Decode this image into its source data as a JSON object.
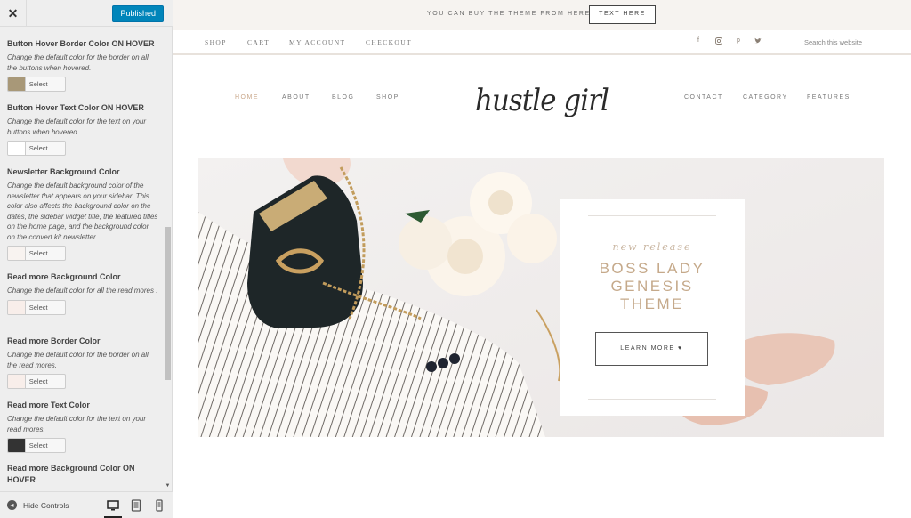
{
  "sidebar": {
    "close_icon": "close-icon",
    "published_label": "Published",
    "settings": [
      {
        "title": "Button Hover Border Color ON HOVER",
        "desc": "Change the default color for the border on all the buttons when hovered.",
        "color": "#a89878",
        "picker_label": "Select Color"
      },
      {
        "title": "Button Hover Text Color ON HOVER",
        "desc": "Change the default color for the text on your buttons when hovered.",
        "color": "#ffffff",
        "picker_label": "Select Color"
      },
      {
        "title": "Newsletter Background Color",
        "desc": "Change the default background color of the newsletter that appears on your sidebar. This color also affects the background color on the dates, the sidebar widget title, the featured titles on the home page, and the background color on the convert kit newsletter.",
        "color": "#f8f3f0",
        "picker_label": "Select Color"
      },
      {
        "title": "Read more Background Color",
        "desc": "Change the default color for all the read mores .",
        "color": "#f8eeea",
        "picker_label": "Select Color"
      },
      {
        "title": "Read more Border Color",
        "desc": "Change the default color for the border on all the read mores.",
        "color": "#f8eeea",
        "picker_label": "Select Color"
      },
      {
        "title": "Read more Text Color",
        "desc": "Change the default color for the text on your read mores.",
        "color": "#333333",
        "picker_label": "Select Color"
      },
      {
        "title": "Read more Background Color ON HOVER",
        "desc": "",
        "color": "",
        "picker_label": ""
      }
    ],
    "hide_controls_label": "Hide Controls",
    "devices": [
      "desktop-icon",
      "tablet-icon",
      "mobile-icon"
    ]
  },
  "site": {
    "announcement": {
      "text": "YOU CAN BUY THE THEME FROM HERE →",
      "button_label": "TEXT HERE"
    },
    "top_nav": [
      "SHOP",
      "CART",
      "MY ACCOUNT",
      "CHECKOUT"
    ],
    "social_icons": [
      "facebook-icon",
      "instagram-icon",
      "pinterest-icon",
      "twitter-icon"
    ],
    "search_placeholder": "Search this website",
    "main_nav_left": [
      "HOME",
      "ABOUT",
      "BLOG",
      "SHOP"
    ],
    "main_nav_right": [
      "CONTACT",
      "CATEGORY",
      "FEATURES"
    ],
    "logo_text": "hustle girl",
    "hero": {
      "eyebrow": "new release",
      "title_lines": [
        "BOSS LADY",
        "GENESIS",
        "THEME"
      ],
      "button_label": "LEARN MORE ♥"
    }
  },
  "colors": {
    "accent_blue": "#0085ba",
    "gold": "#c5a98a",
    "announce_bg": "#f6f3f0"
  }
}
